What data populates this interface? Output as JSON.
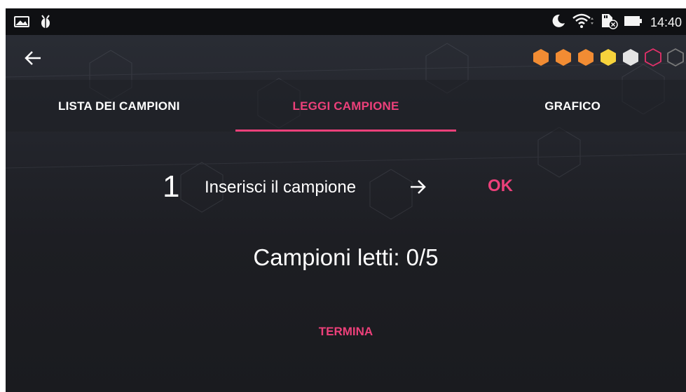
{
  "status_bar": {
    "icons": [
      "image-icon",
      "android-debug-icon",
      "moon-icon",
      "wifi-icon",
      "sim-card-icon",
      "battery-icon"
    ],
    "time": "14:40"
  },
  "toolbar": {
    "back_icon": "arrow-back-icon",
    "progress_hexagons": [
      {
        "state": "filled",
        "color": "#f28c33"
      },
      {
        "state": "filled",
        "color": "#f28c33"
      },
      {
        "state": "filled",
        "color": "#f28c33"
      },
      {
        "state": "filled",
        "color": "#f7d33c"
      },
      {
        "state": "filled",
        "color": "#e4e4e4"
      },
      {
        "state": "outline",
        "color": "#e4306a"
      },
      {
        "state": "outline",
        "color": "#7a7a7a"
      }
    ]
  },
  "tabs": [
    {
      "label": "LISTA DEI CAMPIONI",
      "active": false
    },
    {
      "label": "LEGGI CAMPIONE",
      "active": true
    },
    {
      "label": "GRAFICO",
      "active": false
    }
  ],
  "step": {
    "number": "1",
    "instruction": "Inserisci il campione",
    "arrow_icon": "arrow-right-icon",
    "ok_label": "OK"
  },
  "counter": {
    "text": "Campioni letti: 0/5"
  },
  "actions": {
    "finish_label": "TERMINA"
  },
  "colors": {
    "accent": "#ec407a",
    "status_bar": "#0f1013",
    "background": "#1d1e23"
  }
}
